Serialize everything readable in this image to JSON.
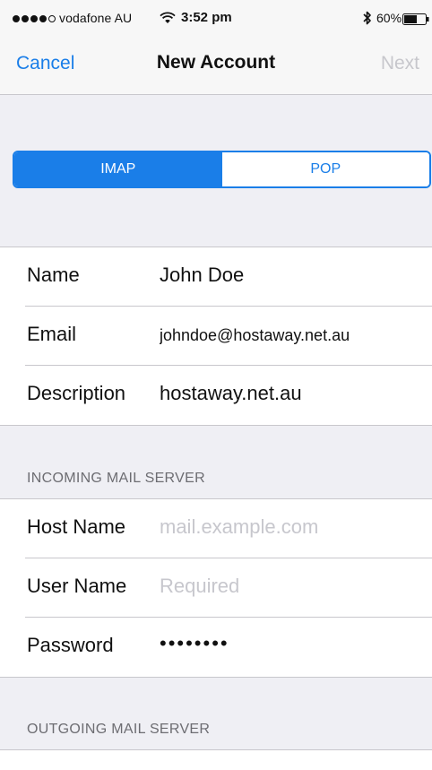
{
  "status_bar": {
    "carrier": "vodafone AU",
    "time": "3:52 pm",
    "battery": "60%"
  },
  "nav": {
    "left": "Cancel",
    "title": "New Account",
    "right": "Next"
  },
  "segmented": {
    "options": [
      "IMAP",
      "POP"
    ],
    "selected": "IMAP"
  },
  "account": {
    "name_label": "Name",
    "name_value": "John Doe",
    "email_label": "Email",
    "email_value": "johndoe@hostaway.net.au",
    "description_label": "Description",
    "description_value": "hostaway.net.au"
  },
  "incoming": {
    "header": "INCOMING MAIL SERVER",
    "host_label": "Host Name",
    "host_placeholder": "mail.example.com",
    "user_label": "User Name",
    "user_placeholder": "Required",
    "password_label": "Password",
    "password_value": "••••••••"
  },
  "outgoing": {
    "header": "OUTGOING MAIL SERVER"
  },
  "colors": {
    "accent": "#1a7ee8",
    "background": "#efeff4",
    "separator": "#c8c7cc",
    "placeholder": "#c7c7cd"
  }
}
